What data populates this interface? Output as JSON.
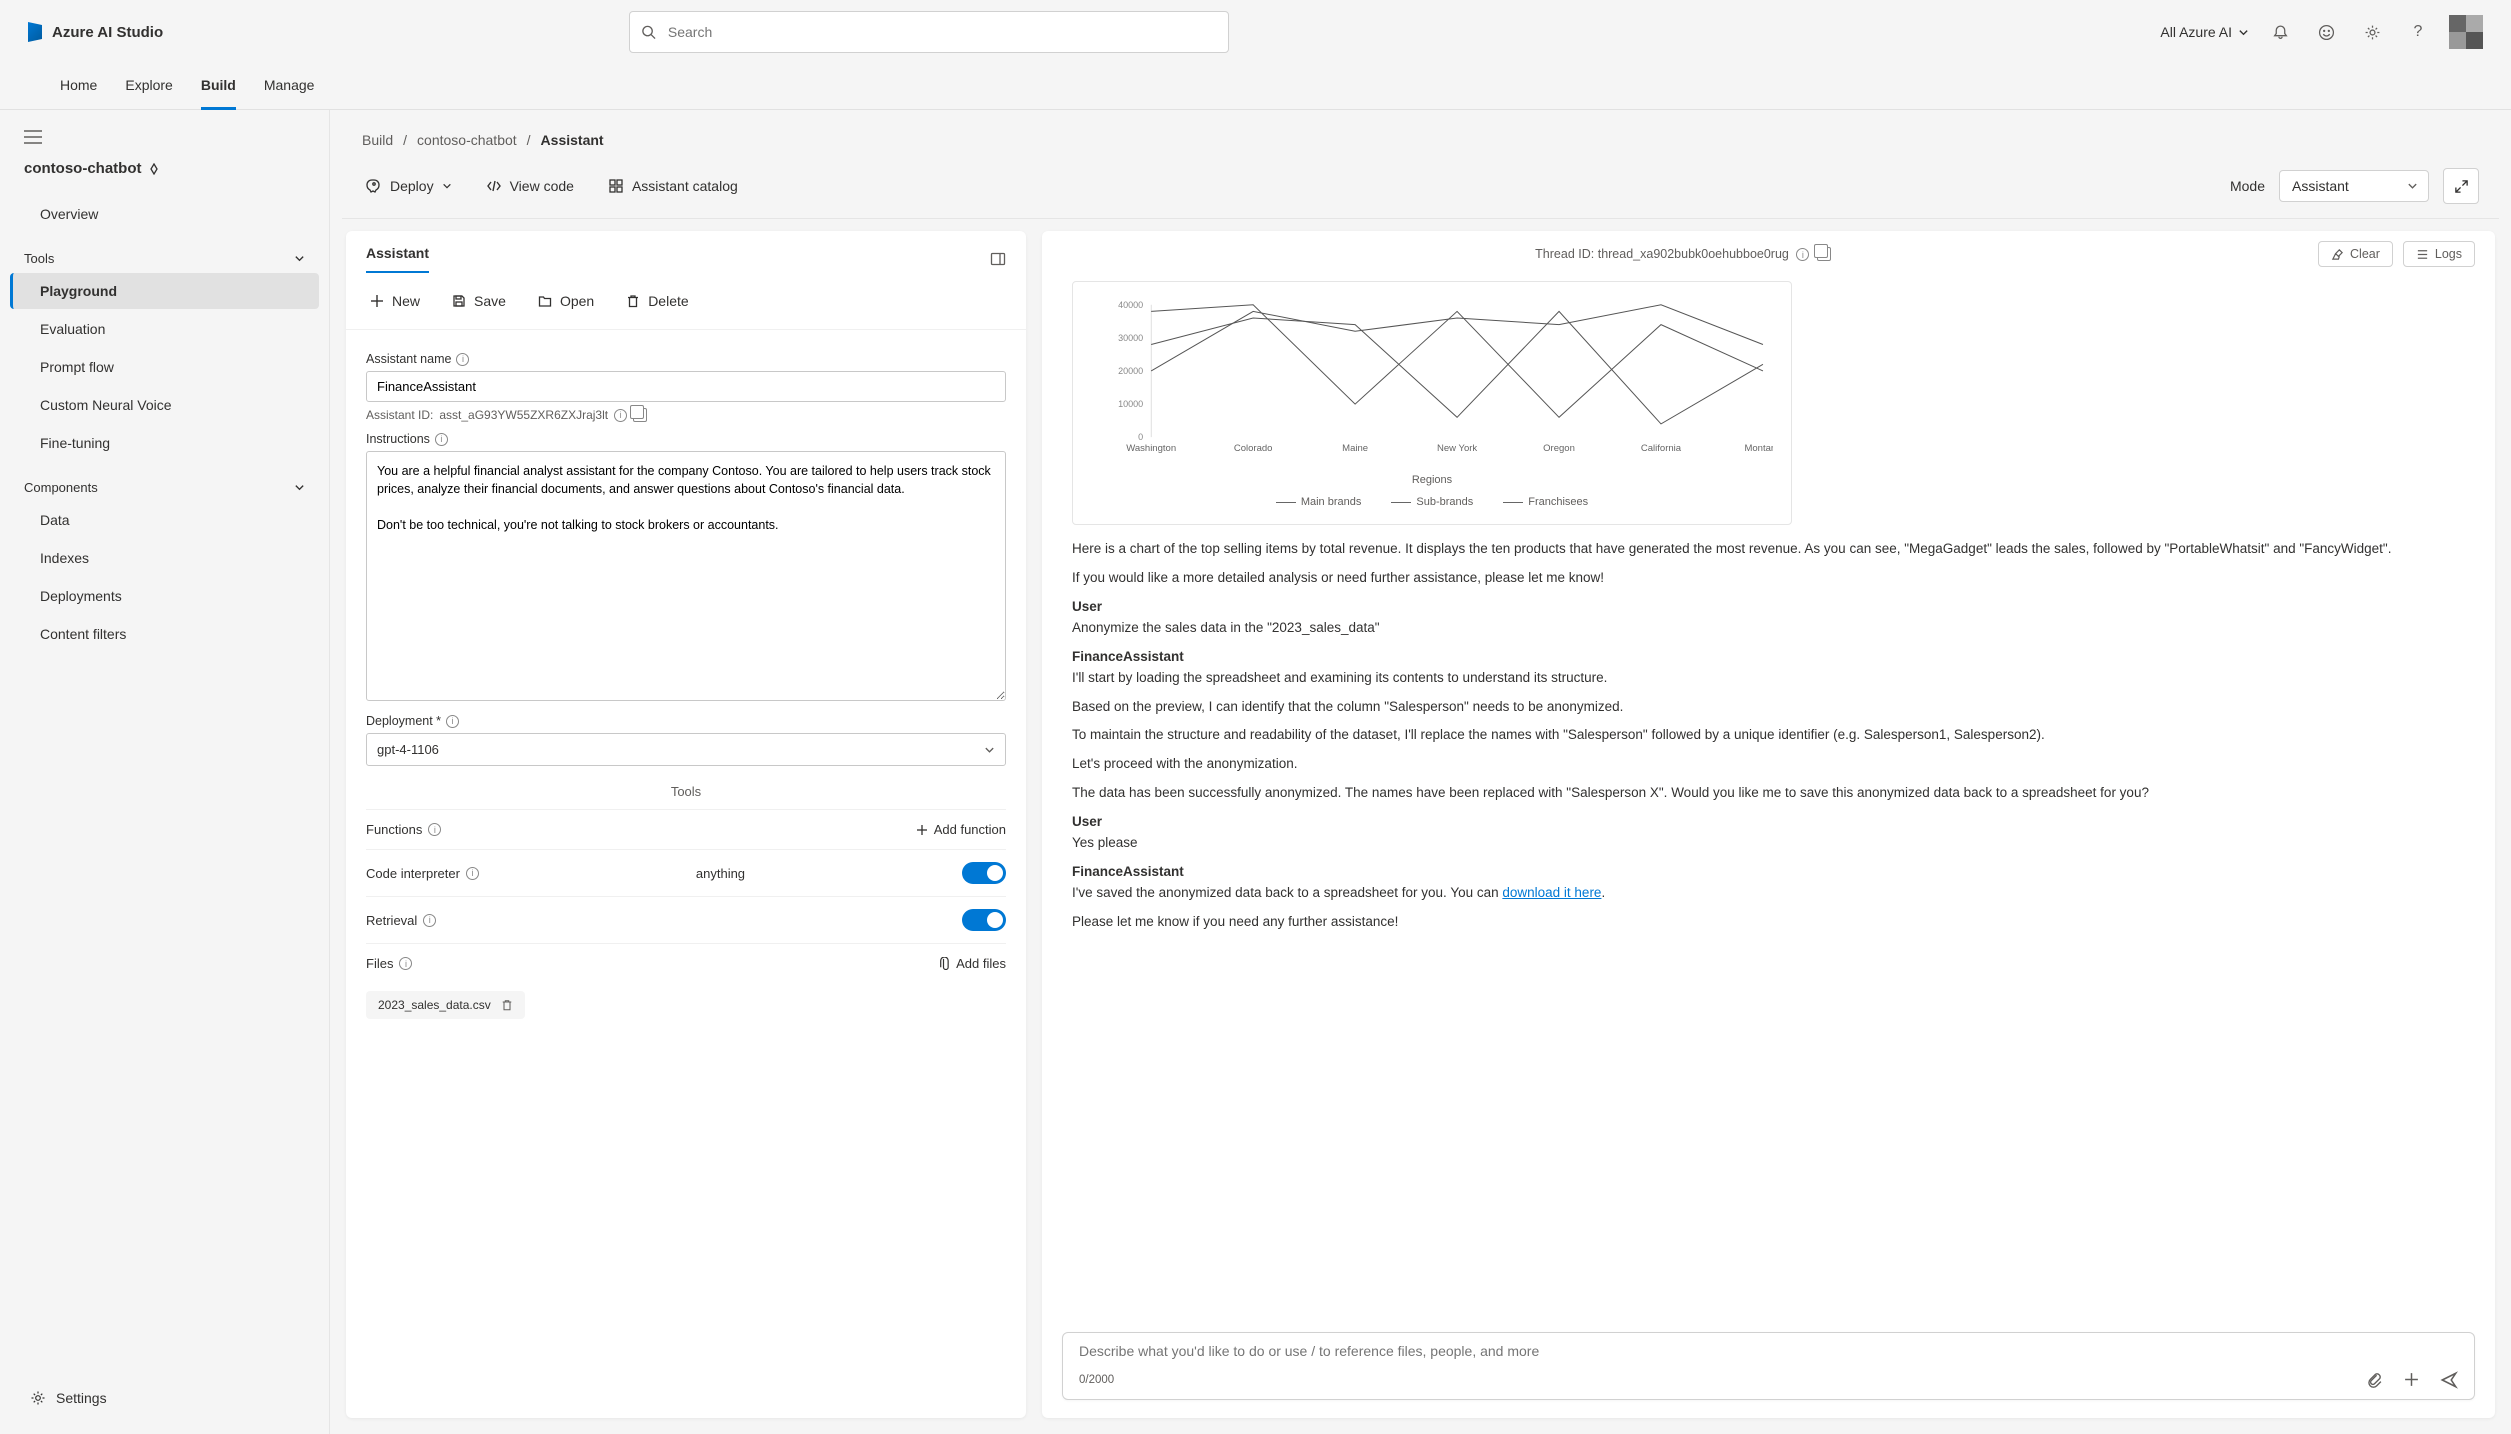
{
  "brand": "Azure AI Studio",
  "search_placeholder": "Search",
  "scope_label": "All Azure AI",
  "nav_tabs": [
    "Home",
    "Explore",
    "Build",
    "Manage"
  ],
  "nav_active_index": 2,
  "project_name": "contoso-chatbot",
  "sidebar": {
    "overview": "Overview",
    "tools_section": "Tools",
    "tools": [
      "Playground",
      "Evaluation",
      "Prompt flow",
      "Custom Neural Voice",
      "Fine-tuning"
    ],
    "tools_active_index": 0,
    "components_section": "Components",
    "components": [
      "Data",
      "Indexes",
      "Deployments",
      "Content filters"
    ],
    "settings": "Settings"
  },
  "breadcrumb": [
    "Build",
    "contoso-chatbot",
    "Assistant"
  ],
  "toolbar": {
    "deploy": "Deploy",
    "view_code": "View code",
    "catalog": "Assistant catalog",
    "mode_label": "Mode",
    "mode_value": "Assistant"
  },
  "assistant_panel": {
    "title": "Assistant",
    "actions": {
      "new": "New",
      "save": "Save",
      "open": "Open",
      "delete": "Delete"
    },
    "name_label": "Assistant name",
    "name_value": "FinanceAssistant",
    "id_label": "Assistant ID:",
    "id_value": "asst_aG93YW55ZXR6ZXJraj3lt",
    "instr_label": "Instructions",
    "instr_value": "You are a helpful financial analyst assistant for the company Contoso. You are tailored to help users track stock prices, analyze their financial documents, and answer questions about Contoso's financial data.\n\nDon't be too technical, you're not talking to stock brokers or accountants.",
    "deployment_label": "Deployment *",
    "deployment_value": "gpt-4-1106",
    "tools_heading": "Tools",
    "functions_label": "Functions",
    "add_function": "Add function",
    "code_interpreter_label": "Code interpreter",
    "retrieval_label": "Retrieval",
    "files_label": "Files",
    "add_files": "Add files",
    "file_chip": "2023_sales_data.csv"
  },
  "chat_panel": {
    "thread_label": "Thread ID:",
    "thread_id": "thread_xa902bubk0oehubboe0rug",
    "clear": "Clear",
    "logs": "Logs",
    "axis_label": "Regions",
    "msg1": "Here is a chart of the top selling items by total revenue. It displays the ten products that have generated the most revenue. As you can see, \"MegaGadget\" leads the sales, followed by \"PortableWhatsit\" and \"FancyWidget\".",
    "msg1b": "If you would like a more detailed analysis or need further assistance, please let me know!",
    "user_label": "User",
    "user_msg1": "Anonymize the sales data in the \"2023_sales_data\"",
    "assistant_label": "FinanceAssistant",
    "a_msg1": "I'll start by loading the spreadsheet and examining its contents to understand its structure.",
    "a_msg2": "Based on the preview, I can identify that the column \"Salesperson\" needs to be anonymized.",
    "a_msg3": "To maintain the structure and readability of the dataset, I'll replace the names with \"Salesperson\" followed by a unique identifier (e.g. Salesperson1, Salesperson2).",
    "a_msg4": "Let's proceed with the anonymization.",
    "a_msg5": "The data has been successfully anonymized. The names have been replaced with \"Salesperson X\". Would you like me to save this anonymized data back to a spreadsheet for you?",
    "user_msg2": "Yes please",
    "a_msg6a": "I've saved the anonymized data back to a spreadsheet for you. You can ",
    "a_msg6_link": "download it here",
    "a_msg6b": ".",
    "a_msg7": "Please let me know if you need any further assistance!",
    "input_placeholder": "Describe what you'd like to do or use / to reference files, people, and more",
    "char_count": "0/2000"
  },
  "chart_data": {
    "type": "line",
    "xlabel": "Regions",
    "ylabel": "",
    "ylim": [
      0,
      40000
    ],
    "y_ticks": [
      0,
      10000,
      20000,
      30000,
      40000
    ],
    "categories": [
      "Washington",
      "Colorado",
      "Maine",
      "New York",
      "Oregon",
      "California",
      "Montana"
    ],
    "series": [
      {
        "name": "Main brands",
        "values": [
          20000,
          38000,
          32000,
          36000,
          34000,
          40000,
          28000
        ]
      },
      {
        "name": "Sub-brands",
        "values": [
          38000,
          40000,
          10000,
          38000,
          6000,
          34000,
          20000
        ]
      },
      {
        "name": "Franchisees",
        "values": [
          28000,
          36000,
          34000,
          6000,
          38000,
          4000,
          22000
        ]
      }
    ]
  }
}
